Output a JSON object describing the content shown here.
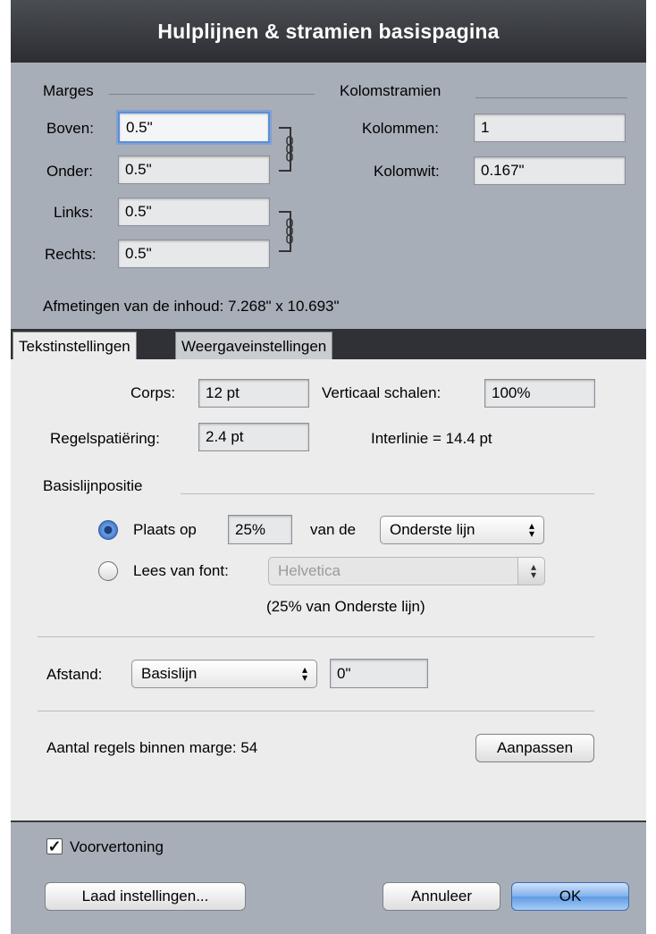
{
  "title": "Hulplijnen & stramien basispagina",
  "margins": {
    "header": "Marges",
    "top_label": "Boven:",
    "top_value": "0.5\"",
    "bottom_label": "Onder:",
    "bottom_value": "0.5\"",
    "left_label": "Links:",
    "left_value": "0.5\"",
    "right_label": "Rechts:",
    "right_value": "0.5\""
  },
  "columns": {
    "header": "Kolomstramien",
    "count_label": "Kolommen:",
    "count_value": "1",
    "gutter_label": "Kolomwit:",
    "gutter_value": "0.167\""
  },
  "content_size": "Afmetingen van de inhoud:  7.268\" x 10.693\"",
  "tabs": [
    {
      "label": "Tekstinstellingen",
      "active": true
    },
    {
      "label": "Weergaveinstellingen",
      "active": false
    }
  ],
  "text": {
    "corps_label": "Corps:",
    "corps_value": "12 pt",
    "vscale_label": "Verticaal schalen:",
    "vscale_value": "100%",
    "spacing_label": "Regelspatiëring:",
    "spacing_value": "2.4 pt",
    "leading_text": "Interlinie  =  14.4 pt",
    "baseline_header": "Basislijnpositie",
    "place_label": "Plaats op",
    "place_value": "25%",
    "place_of": "van de",
    "place_select": "Onderste lijn",
    "read_label": "Lees van font:",
    "read_select": "Helvetica",
    "baseline_note": "(25% van Onderste lijn)",
    "distance_label": "Afstand:",
    "distance_select": "Basislijn",
    "distance_value": "0\"",
    "lines_text": "Aantal regels binnen marge:  54",
    "adjust_button": "Aanpassen"
  },
  "footer": {
    "preview_label": "Voorvertoning",
    "preview_checked": true,
    "load_button": "Laad instellingen...",
    "cancel_button": "Annuleer",
    "ok_button": "OK"
  }
}
